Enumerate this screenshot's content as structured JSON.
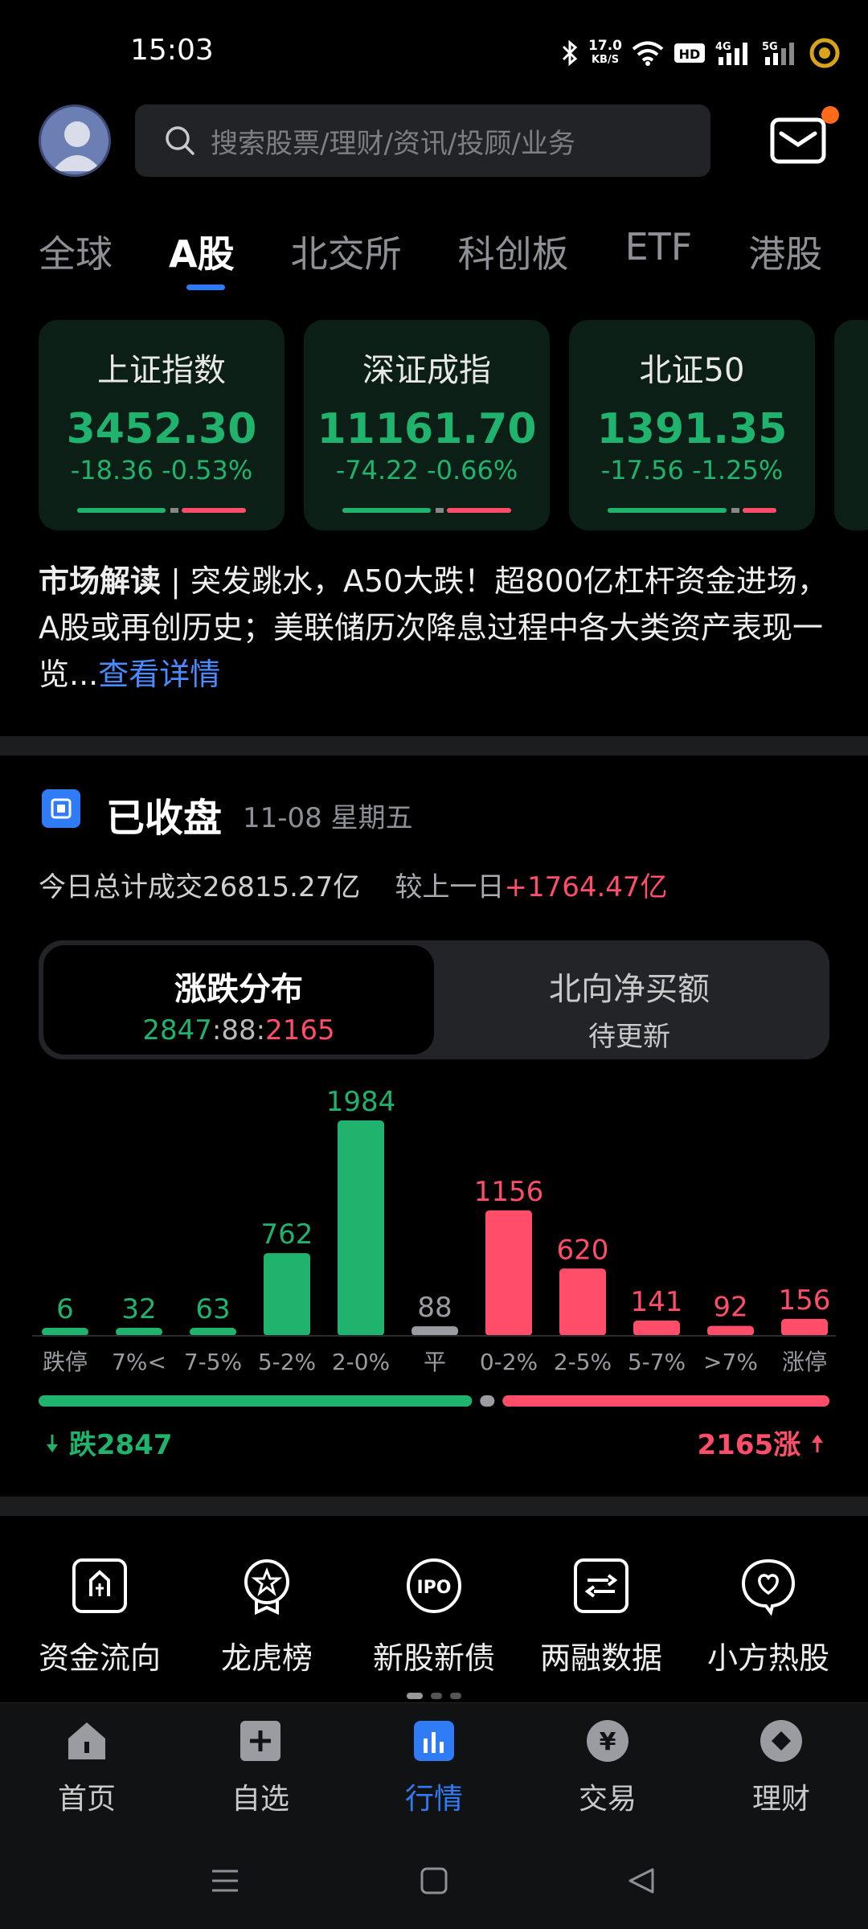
{
  "status_bar": {
    "time": "15:03",
    "net_speed_value": "17.0",
    "net_speed_unit": "KB/S",
    "icons": [
      "bluetooth-icon",
      "wifi-icon",
      "hd-icon",
      "signal-4g-icon",
      "signal-5g-icon",
      "battery-icon"
    ]
  },
  "header": {
    "search_placeholder": "搜索股票/理财/资讯/投顾/业务"
  },
  "tabs": [
    "全球",
    "A股",
    "北交所",
    "科创板",
    "ETF",
    "港股"
  ],
  "active_tab": "A股",
  "indices": [
    {
      "name": "上证指数",
      "value": "3452.30",
      "change": "-18.36",
      "pct": "-0.53%"
    },
    {
      "name": "深证成指",
      "value": "11161.70",
      "change": "-74.22",
      "pct": "-0.66%"
    },
    {
      "name": "北证50",
      "value": "1391.35",
      "change": "-17.56",
      "pct": "-1.25%"
    }
  ],
  "news": {
    "label": "市场解读",
    "text": "突发跳水，A50大跌！超800亿杠杆资金进场，A股或再创历史；美联储历次降息过程中各大类资产表现一览...",
    "link": "查看详情"
  },
  "closed": {
    "title": "已收盘",
    "date": "11-08 星期五",
    "volume_prefix": "今日总计成交",
    "volume": "26815.27亿",
    "compare_prefix": "较上一日",
    "compare": "+1764.47亿"
  },
  "segment": {
    "left_title": "涨跌分布",
    "down": "2847",
    "flat": "88",
    "up": "2165",
    "right_title": "北向净买额",
    "right_sub": "待更新"
  },
  "chart_data": {
    "type": "bar",
    "title": "涨跌分布",
    "categories": [
      "跌停",
      "7%<",
      "7-5%",
      "5-2%",
      "2-0%",
      "平",
      "0-2%",
      "2-5%",
      "5-7%",
      ">7%",
      "涨停"
    ],
    "values": [
      6,
      32,
      63,
      762,
      1984,
      88,
      1156,
      620,
      141,
      92,
      156
    ],
    "colors": [
      "#20b36e",
      "#20b36e",
      "#20b36e",
      "#20b36e",
      "#20b36e",
      "#9a9ca2",
      "#ff4d6a",
      "#ff4d6a",
      "#ff4d6a",
      "#ff4d6a",
      "#ff4d6a"
    ],
    "grid": false
  },
  "ratio": {
    "fall_label": "跌2847",
    "rise_label": "2165涨",
    "fall": 2847,
    "flat": 88,
    "rise": 2165
  },
  "tools": [
    {
      "label": "资金流向",
      "icon": "fund-flow-icon"
    },
    {
      "label": "龙虎榜",
      "icon": "dragon-tiger-icon"
    },
    {
      "label": "新股新债",
      "icon": "ipo-icon"
    },
    {
      "label": "两融数据",
      "icon": "margin-data-icon"
    },
    {
      "label": "小方热股",
      "icon": "hot-stock-icon"
    }
  ],
  "nav": [
    {
      "label": "首页",
      "icon": "home-icon"
    },
    {
      "label": "自选",
      "icon": "watchlist-icon"
    },
    {
      "label": "行情",
      "icon": "market-icon"
    },
    {
      "label": "交易",
      "icon": "trade-icon"
    },
    {
      "label": "理财",
      "icon": "wealth-icon"
    }
  ],
  "active_nav": "行情",
  "colors": {
    "down": "#20b36e",
    "up": "#ff4d6a",
    "accent": "#2f7cf6"
  }
}
